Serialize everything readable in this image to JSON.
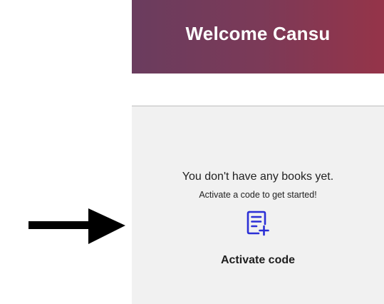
{
  "header": {
    "title": "Welcome Cansu"
  },
  "empty_state": {
    "message": "You don't have any books yet.",
    "hint": "Activate a code to get started!"
  },
  "activate": {
    "icon": "document-add-icon",
    "label": "Activate code"
  },
  "colors": {
    "header_gradient_start": "#6a3c5e",
    "header_gradient_end": "#953449",
    "panel_background": "#f1f1f1",
    "accent_icon": "#2b2fd6",
    "annotation_arrow": "#000000"
  },
  "annotation": {
    "icon": "arrow-right-icon"
  }
}
